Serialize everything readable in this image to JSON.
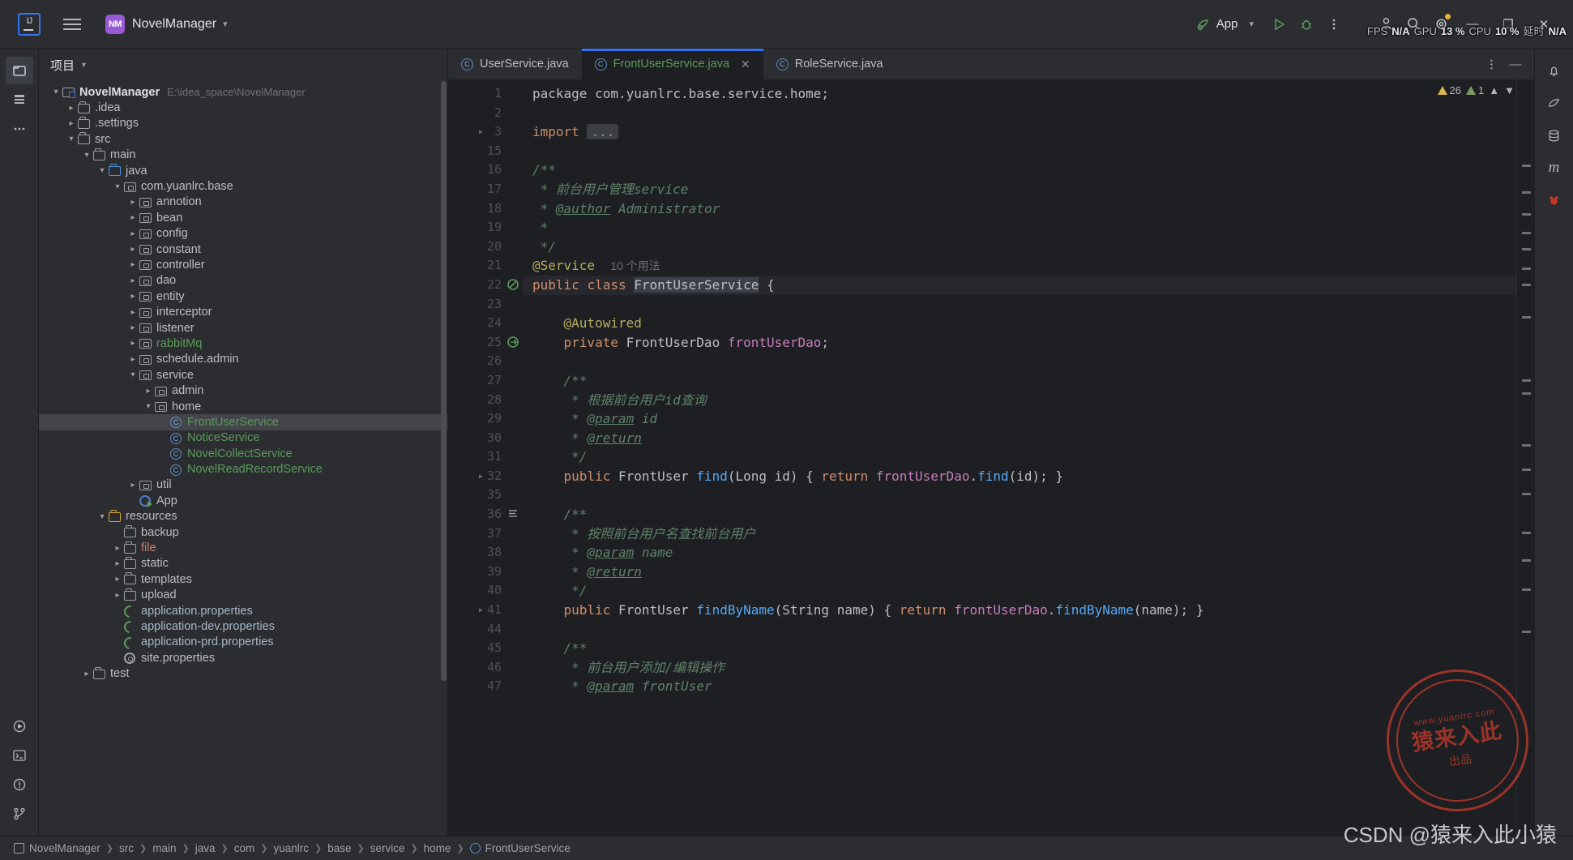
{
  "titlebar": {
    "project_badge": "NM",
    "project_name": "NovelManager",
    "run_config": "App",
    "menu_icon": "hamburger-icon",
    "perf": {
      "fps_label": "FPS",
      "fps_value": "N/A",
      "gpu_label": "GPU",
      "gpu_value": "13 %",
      "cpu_label": "CPU",
      "cpu_value": "10 %",
      "latency_label": "延时",
      "latency_value": "N/A"
    },
    "window_controls": {
      "minimize": "—",
      "maximize": "❐",
      "close": "✕"
    }
  },
  "project_panel": {
    "title": "项目",
    "tree": [
      {
        "depth": 0,
        "arrow": "down",
        "icon": "module",
        "label": "NovelManager",
        "bold": true,
        "path": "E:\\idea_space\\NovelManager"
      },
      {
        "depth": 1,
        "arrow": "right",
        "icon": "folder",
        "label": ".idea"
      },
      {
        "depth": 1,
        "arrow": "right",
        "icon": "folder",
        "label": ".settings"
      },
      {
        "depth": 1,
        "arrow": "down",
        "icon": "folder",
        "label": "src"
      },
      {
        "depth": 2,
        "arrow": "down",
        "icon": "folder",
        "label": "main"
      },
      {
        "depth": 3,
        "arrow": "down",
        "icon": "srcfolder",
        "label": "java"
      },
      {
        "depth": 4,
        "arrow": "down",
        "icon": "package",
        "label": "com.yuanlrc.base"
      },
      {
        "depth": 5,
        "arrow": "right",
        "icon": "package",
        "label": "annotion"
      },
      {
        "depth": 5,
        "arrow": "right",
        "icon": "package",
        "label": "bean"
      },
      {
        "depth": 5,
        "arrow": "right",
        "icon": "package",
        "label": "config"
      },
      {
        "depth": 5,
        "arrow": "right",
        "icon": "package",
        "label": "constant"
      },
      {
        "depth": 5,
        "arrow": "right",
        "icon": "package",
        "label": "controller"
      },
      {
        "depth": 5,
        "arrow": "right",
        "icon": "package",
        "label": "dao"
      },
      {
        "depth": 5,
        "arrow": "right",
        "icon": "package",
        "label": "entity"
      },
      {
        "depth": 5,
        "arrow": "right",
        "icon": "package",
        "label": "interceptor"
      },
      {
        "depth": 5,
        "arrow": "right",
        "icon": "package",
        "label": "listener"
      },
      {
        "depth": 5,
        "arrow": "right",
        "icon": "package",
        "label": "rabbitMq",
        "color": "green"
      },
      {
        "depth": 5,
        "arrow": "right",
        "icon": "package",
        "label": "schedule.admin"
      },
      {
        "depth": 5,
        "arrow": "down",
        "icon": "package",
        "label": "service"
      },
      {
        "depth": 6,
        "arrow": "right",
        "icon": "package",
        "label": "admin"
      },
      {
        "depth": 6,
        "arrow": "down",
        "icon": "package",
        "label": "home"
      },
      {
        "depth": 7,
        "arrow": "none",
        "icon": "class",
        "label": "FrontUserService",
        "color": "green",
        "selected": true
      },
      {
        "depth": 7,
        "arrow": "none",
        "icon": "class",
        "label": "NoticeService",
        "color": "green"
      },
      {
        "depth": 7,
        "arrow": "none",
        "icon": "class",
        "label": "NovelCollectService",
        "color": "green"
      },
      {
        "depth": 7,
        "arrow": "none",
        "icon": "class",
        "label": "NovelReadRecordService",
        "color": "green"
      },
      {
        "depth": 5,
        "arrow": "right",
        "icon": "package",
        "label": "util"
      },
      {
        "depth": 5,
        "arrow": "none",
        "icon": "app",
        "label": "App"
      },
      {
        "depth": 3,
        "arrow": "down",
        "icon": "resfolder",
        "label": "resources"
      },
      {
        "depth": 4,
        "arrow": "none",
        "icon": "folder",
        "label": "backup"
      },
      {
        "depth": 4,
        "arrow": "right",
        "icon": "folder",
        "label": "file",
        "color": "red"
      },
      {
        "depth": 4,
        "arrow": "right",
        "icon": "folder",
        "label": "static"
      },
      {
        "depth": 4,
        "arrow": "right",
        "icon": "folder",
        "label": "templates"
      },
      {
        "depth": 4,
        "arrow": "right",
        "icon": "folder",
        "label": "upload"
      },
      {
        "depth": 4,
        "arrow": "none",
        "icon": "spring",
        "label": "application.properties",
        "color": "blue"
      },
      {
        "depth": 4,
        "arrow": "none",
        "icon": "spring",
        "label": "application-dev.properties",
        "color": "blue"
      },
      {
        "depth": 4,
        "arrow": "none",
        "icon": "spring",
        "label": "application-prd.properties",
        "color": "blue"
      },
      {
        "depth": 4,
        "arrow": "none",
        "icon": "gear",
        "label": "site.properties"
      },
      {
        "depth": 2,
        "arrow": "right",
        "icon": "folder",
        "label": "test"
      }
    ]
  },
  "editor": {
    "tabs": [
      {
        "label": "UserService.java",
        "active": false,
        "closable": false
      },
      {
        "label": "FrontUserService.java",
        "active": true,
        "closable": true
      },
      {
        "label": "RoleService.java",
        "active": false,
        "closable": false
      }
    ],
    "inspections": {
      "warnings": "26",
      "weak_warnings": "1"
    },
    "lines": [
      {
        "no": "1",
        "fold": "",
        "gmark": "",
        "text": "package com.yuanlrc.base.service.home;"
      },
      {
        "no": "2",
        "fold": "",
        "gmark": "",
        "text": ""
      },
      {
        "no": "3",
        "fold": ">",
        "gmark": "",
        "text": "import ..."
      },
      {
        "no": "15",
        "fold": "",
        "gmark": "",
        "text": ""
      },
      {
        "no": "16",
        "fold": "",
        "gmark": "",
        "text": "/**"
      },
      {
        "no": "17",
        "fold": "",
        "gmark": "",
        "text": " * 前台用户管理service"
      },
      {
        "no": "18",
        "fold": "",
        "gmark": "",
        "text": " * @author Administrator"
      },
      {
        "no": "19",
        "fold": "",
        "gmark": "",
        "text": " *"
      },
      {
        "no": "20",
        "fold": "",
        "gmark": "",
        "text": " */"
      },
      {
        "no": "21",
        "fold": "",
        "gmark": "",
        "text": "@Service",
        "hint": "10 个用法"
      },
      {
        "no": "22",
        "fold": "",
        "gmark": "bean",
        "text": "public class FrontUserService {",
        "current": true
      },
      {
        "no": "23",
        "fold": "",
        "gmark": "",
        "text": ""
      },
      {
        "no": "24",
        "fold": "",
        "gmark": "",
        "text": "    @Autowired"
      },
      {
        "no": "25",
        "fold": "",
        "gmark": "arrow",
        "text": "    private FrontUserDao frontUserDao;"
      },
      {
        "no": "26",
        "fold": "",
        "gmark": "",
        "text": ""
      },
      {
        "no": "27",
        "fold": "",
        "gmark": "",
        "text": "    /**"
      },
      {
        "no": "28",
        "fold": "",
        "gmark": "",
        "text": "     * 根据前台用户id查询"
      },
      {
        "no": "29",
        "fold": "",
        "gmark": "",
        "text": "     * @param id"
      },
      {
        "no": "30",
        "fold": "",
        "gmark": "",
        "text": "     * @return"
      },
      {
        "no": "31",
        "fold": "",
        "gmark": "",
        "text": "     */"
      },
      {
        "no": "32",
        "fold": ">",
        "gmark": "",
        "text": "    public FrontUser find(Long id) { return frontUserDao.find(id); }"
      },
      {
        "no": "35",
        "fold": "",
        "gmark": "",
        "text": ""
      },
      {
        "no": "36",
        "fold": "",
        "gmark": "doc",
        "text": "    /**"
      },
      {
        "no": "37",
        "fold": "",
        "gmark": "",
        "text": "     * 按照前台用户名查找前台用户"
      },
      {
        "no": "38",
        "fold": "",
        "gmark": "",
        "text": "     * @param name"
      },
      {
        "no": "39",
        "fold": "",
        "gmark": "",
        "text": "     * @return"
      },
      {
        "no": "40",
        "fold": "",
        "gmark": "",
        "text": "     */"
      },
      {
        "no": "41",
        "fold": ">",
        "gmark": "",
        "text": "    public FrontUser findByName(String name) { return frontUserDao.findByName(name); }"
      },
      {
        "no": "44",
        "fold": "",
        "gmark": "",
        "text": ""
      },
      {
        "no": "45",
        "fold": "",
        "gmark": "",
        "text": "    /**"
      },
      {
        "no": "46",
        "fold": "",
        "gmark": "",
        "text": "     * 前台用户添加/编辑操作"
      },
      {
        "no": "47",
        "fold": "",
        "gmark": "",
        "text": "     * @param frontUser"
      }
    ]
  },
  "statusbar": {
    "crumbs": [
      {
        "label": "NovelManager",
        "icon": "module"
      },
      {
        "label": "src",
        "icon": "none"
      },
      {
        "label": "main",
        "icon": "none"
      },
      {
        "label": "java",
        "icon": "none"
      },
      {
        "label": "com",
        "icon": "none"
      },
      {
        "label": "yuanlrc",
        "icon": "none"
      },
      {
        "label": "base",
        "icon": "none"
      },
      {
        "label": "service",
        "icon": "none"
      },
      {
        "label": "home",
        "icon": "none"
      },
      {
        "label": "FrontUserService",
        "icon": "class"
      }
    ]
  },
  "watermarks": {
    "csdn": "CSDN @猿来入此小猿",
    "stamp_top": "www.yuanlrc.com",
    "stamp_main": "猿来入此",
    "stamp_sub": "出品"
  },
  "colors": {
    "accent": "#3574f0",
    "tab_active_text": "#5a9a5a",
    "badge_purple": "#9759d4",
    "warn_yellow": "#d9b44a",
    "stamp_red": "#c0392b"
  }
}
